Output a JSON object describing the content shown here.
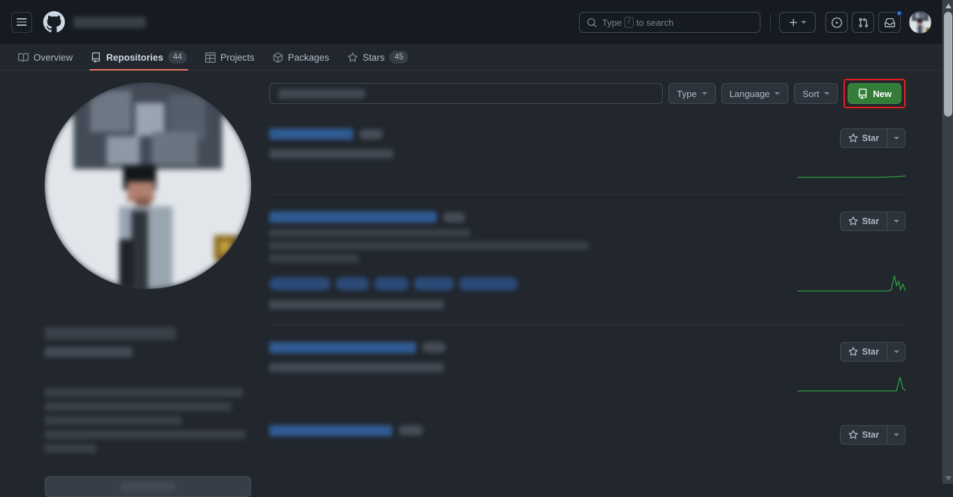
{
  "theme": {
    "header_bg": "#161b22",
    "body_bg": "#22272e",
    "accent_green": "#347d39",
    "tab_underline": "#ec775c",
    "highlight_red": "#ee1e1e",
    "sparkline_green": "#2ea043",
    "link_blue": "#539bf5"
  },
  "header": {
    "menu_label": "Open global navigation menu",
    "logo_label": "GitHub homepage",
    "owner_redacted": "██████████",
    "search": {
      "prefix": "Type",
      "key": "/",
      "suffix": "to search",
      "placeholder": "Type / to search"
    },
    "actions": [
      {
        "name": "create-new-menu",
        "icon": "plus-icon"
      },
      {
        "name": "issues-link",
        "icon": "issue-opened-icon"
      },
      {
        "name": "pull-requests-link",
        "icon": "git-pull-request-icon"
      },
      {
        "name": "notifications-link",
        "icon": "inbox-icon",
        "has_unread": true
      }
    ],
    "avatar_label": "Open user account menu"
  },
  "nav": {
    "tabs": [
      {
        "label": "Overview",
        "icon": "book-icon",
        "count": null,
        "active": false
      },
      {
        "label": "Repositories",
        "icon": "repo-icon",
        "count": "44",
        "active": true
      },
      {
        "label": "Projects",
        "icon": "table-icon",
        "count": null,
        "active": false
      },
      {
        "label": "Packages",
        "icon": "package-icon",
        "count": null,
        "active": false
      },
      {
        "label": "Stars",
        "icon": "star-icon",
        "count": "45",
        "active": false
      }
    ]
  },
  "sidebar": {
    "avatar_alt": "profile photo",
    "name_redacted": "██████████████████",
    "login_redacted": "████████████",
    "bio_lines_redacted": [
      "████████████████████████████",
      "██████████████████████████",
      "████████████████████",
      "███████████████████████████",
      "████████"
    ],
    "edit_button_redacted": "██████████"
  },
  "toolbar": {
    "find_placeholder_redacted": "██████████████",
    "type_label": "Type",
    "language_label": "Language",
    "sort_label": "Sort",
    "new_label": "New",
    "new_icon": "repo-icon",
    "new_is_highlighted": true
  },
  "repos": [
    {
      "name_redacted": "███████ ██████",
      "visibility_redacted": "████",
      "description_lines": [],
      "topics_count": 0,
      "meta_redacted": "██████  █ ██████ ██████",
      "star_label": "Star",
      "sparkline": [
        0,
        0,
        0,
        0,
        0,
        0,
        0,
        0,
        0,
        0,
        0,
        0,
        0,
        0,
        0,
        0,
        0,
        0,
        0,
        0,
        0,
        0,
        0,
        0,
        0,
        0,
        0,
        0,
        0,
        0,
        0,
        0,
        0,
        0,
        0,
        0,
        0,
        0,
        0.04,
        0.1
      ]
    },
    {
      "name_redacted": "██████ ████████ ███████",
      "visibility_redacted": "████",
      "description_lines": [
        "████████████████████████",
        "████████████████████████████████████████",
        "████████████"
      ],
      "topics_count": 5,
      "meta_redacted": "██████  ████  ██████ ██████",
      "star_label": "Star",
      "sparkline": [
        0,
        0,
        0,
        0,
        0,
        0,
        0,
        0,
        0,
        0,
        0,
        0,
        0,
        0,
        0,
        0,
        0,
        0,
        0,
        0,
        0,
        0,
        0,
        0,
        0,
        0,
        0,
        0,
        0,
        0,
        0,
        0,
        0,
        0,
        0,
        0.05,
        0.95,
        0.25,
        0.75,
        0.15
      ]
    },
    {
      "name_redacted": "██████ ██████████",
      "visibility_redacted": "████",
      "description_lines": [],
      "topics_count": 0,
      "meta_redacted": "██████  ████  ██████ ██████",
      "star_label": "Star",
      "sparkline": [
        0,
        0,
        0,
        0,
        0,
        0,
        0,
        0,
        0,
        0,
        0,
        0,
        0,
        0,
        0,
        0,
        0,
        0,
        0,
        0,
        0,
        0,
        0,
        0,
        0,
        0,
        0,
        0,
        0,
        0,
        0,
        0,
        0,
        0,
        0,
        0,
        0,
        0.9,
        0.2,
        0.1
      ]
    },
    {
      "name_redacted": "██████████████",
      "visibility_redacted": "████",
      "description_lines": [],
      "topics_count": 0,
      "meta_redacted": "",
      "star_label": "Star",
      "sparkline": []
    }
  ],
  "scrollbar": {
    "up_label": "Scroll up",
    "down_label": "Scroll down",
    "thumb_label": "Vertical scrollbar thumb"
  }
}
